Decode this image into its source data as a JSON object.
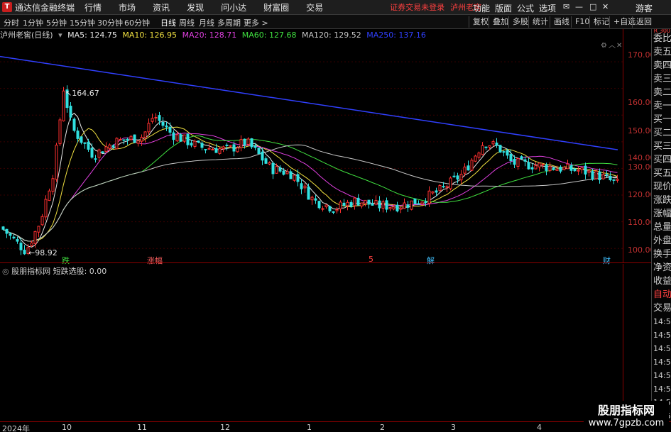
{
  "app": {
    "name": "通达信金融终端",
    "login_status": "证券交易未登录",
    "stock_name": "泸州老窖"
  },
  "menu": [
    "行情",
    "市场",
    "资讯",
    "发现",
    "问小达",
    "财富圈",
    "交易"
  ],
  "right_menu": [
    "功能",
    "版面",
    "公式",
    "选项",
    "游客"
  ],
  "periods": [
    "分时",
    "1分钟",
    "5分钟",
    "15分钟",
    "30分钟",
    "60分钟",
    "日线",
    "周线",
    "月线",
    "多周期",
    "更多"
  ],
  "active_period": "日线",
  "toolbar": [
    "复权",
    "叠加",
    "多股",
    "统计",
    "画线",
    "F10",
    "标记",
    "+自选",
    "返回"
  ],
  "chart_title": "泸州老窖(日线)",
  "ma": [
    {
      "label": "MA5: 124.75",
      "color": "#e6e6e6"
    },
    {
      "label": "MA10: 126.95",
      "color": "#f0e040"
    },
    {
      "label": "MA20: 128.71",
      "color": "#e040e0"
    },
    {
      "label": "MA60: 127.68",
      "color": "#40e040"
    },
    {
      "label": "MA120: 129.52",
      "color": "#c8c8c8"
    },
    {
      "label": "MA250: 137.16",
      "color": "#3040ff"
    }
  ],
  "price_ticks": [
    "170.00",
    "160.00",
    "150.00",
    "140.00",
    "130.00",
    "120.00",
    "110.00",
    "100.00"
  ],
  "sub_ticks": [
    "0.00"
  ],
  "annotations": {
    "high": "164.67",
    "low": "98.92"
  },
  "events": [
    {
      "label": "跌",
      "color": "#40e040"
    },
    {
      "label": "涨幅",
      "color": "#ff6060"
    },
    {
      "label": "5",
      "color": "#ff4040"
    },
    {
      "label": "解",
      "color": "#40c0ff"
    },
    {
      "label": "财",
      "color": "#40c0ff"
    }
  ],
  "sub_title": "股朋指标网 短跌选股: 0.00",
  "side_panel": [
    "委比",
    "卖五",
    "卖四",
    "卖三",
    "卖二",
    "卖一",
    "买一",
    "买二",
    "买三",
    "买四",
    "买五",
    "现价",
    "涨跌",
    "涨幅",
    "总量",
    "外盘",
    "换手",
    "净资",
    "收益",
    "自动",
    "交易",
    "14:56",
    "14:56",
    "14:56",
    "14:56",
    "14:56",
    "14:56",
    "14:56",
    "14:56",
    "14:56",
    "14:56"
  ],
  "date_ticks": [
    "2024年",
    "10",
    "11",
    "12",
    "1",
    "2",
    "3",
    "4"
  ],
  "watermark": {
    "line1": "股朋指标网",
    "line2": "www.7gpzb.com"
  },
  "side_small": "R 300",
  "more_label": "更多 >"
}
